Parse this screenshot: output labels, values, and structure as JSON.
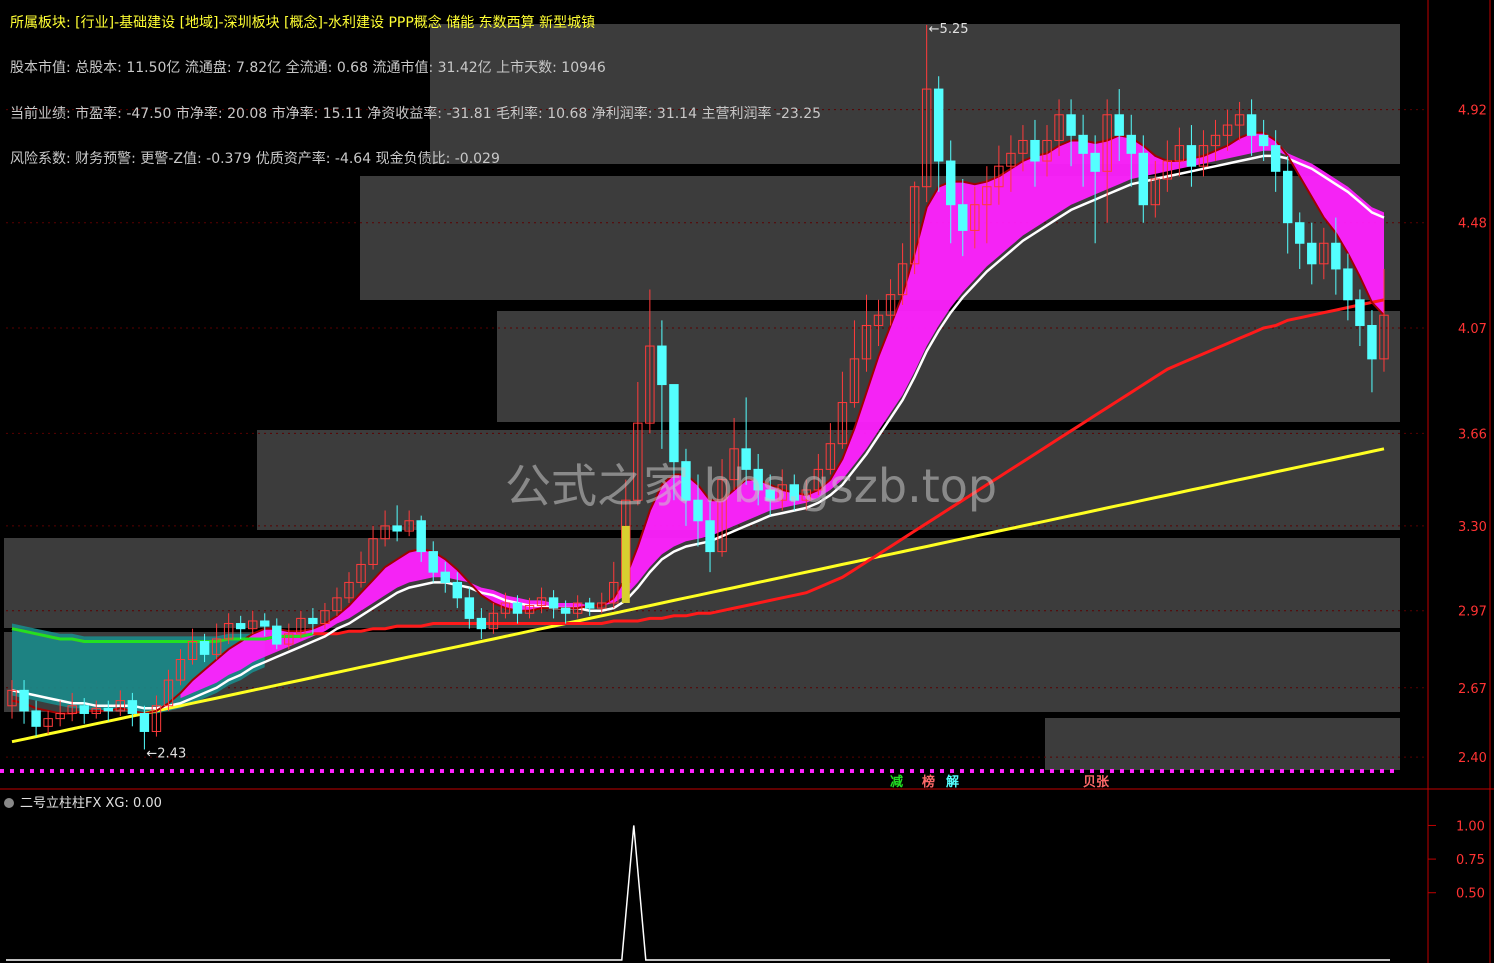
{
  "header": {
    "sector_line": "所属板块: [行业]-基础建设 [地域]-深圳板块 [概念]-水利建设 PPP概念 储能 东数西算 新型城镇",
    "capital_line": "股本市值: 总股本: 11.50亿 流通盘: 7.82亿 全流通: 0.68 流通市值: 31.42亿 上市天数: 10946",
    "performance_line": "当前业绩: 市盈率: -47.50 市净率: 20.08 市净率: 15.11 净资收益率: -31.81 毛利率: 10.68 净利润率: 31.14 主营利润率 -23.25",
    "risk_line": "风险系数: 财务预警: 更警-Z值: -0.379 优质资产率: -4.64 现金负债比: -0.029"
  },
  "watermark": "公式之家 bbs.gszb.top",
  "chart_data": [
    {
      "type": "candlestick",
      "title": "",
      "ylim": [
        2.35,
        5.3
      ],
      "y_ticks": [
        "4.92",
        "4.48",
        "4.07",
        "3.66",
        "3.30",
        "2.97",
        "2.67",
        "2.40"
      ],
      "annotations": {
        "high": "5.25",
        "low": "2.43"
      },
      "signal_labels": [
        "减",
        "榜",
        "解",
        "贝张"
      ],
      "candles": [
        [
          2.6,
          2.66,
          2.55,
          2.7
        ],
        [
          2.66,
          2.58,
          2.53,
          2.7
        ],
        [
          2.58,
          2.52,
          2.48,
          2.62
        ],
        [
          2.52,
          2.55,
          2.49,
          2.58
        ],
        [
          2.55,
          2.57,
          2.52,
          2.62
        ],
        [
          2.57,
          2.6,
          2.54,
          2.65
        ],
        [
          2.6,
          2.57,
          2.53,
          2.63
        ],
        [
          2.57,
          2.59,
          2.55,
          2.62
        ],
        [
          2.59,
          2.58,
          2.54,
          2.62
        ],
        [
          2.58,
          2.62,
          2.56,
          2.66
        ],
        [
          2.62,
          2.57,
          2.52,
          2.65
        ],
        [
          2.57,
          2.5,
          2.43,
          2.6
        ],
        [
          2.5,
          2.6,
          2.48,
          2.64
        ],
        [
          2.6,
          2.7,
          2.58,
          2.74
        ],
        [
          2.7,
          2.78,
          2.68,
          2.82
        ],
        [
          2.78,
          2.85,
          2.76,
          2.9
        ],
        [
          2.85,
          2.8,
          2.77,
          2.88
        ],
        [
          2.8,
          2.86,
          2.78,
          2.92
        ],
        [
          2.86,
          2.92,
          2.84,
          2.96
        ],
        [
          2.92,
          2.9,
          2.86,
          2.95
        ],
        [
          2.9,
          2.93,
          2.88,
          2.97
        ],
        [
          2.93,
          2.91,
          2.87,
          2.96
        ],
        [
          2.91,
          2.84,
          2.82,
          2.94
        ],
        [
          2.84,
          2.88,
          2.82,
          2.92
        ],
        [
          2.88,
          2.94,
          2.86,
          2.97
        ],
        [
          2.94,
          2.92,
          2.88,
          2.98
        ],
        [
          2.92,
          2.97,
          2.9,
          3.0
        ],
        [
          2.97,
          3.02,
          2.95,
          3.06
        ],
        [
          3.02,
          3.08,
          3.0,
          3.12
        ],
        [
          3.08,
          3.15,
          3.06,
          3.2
        ],
        [
          3.15,
          3.25,
          3.13,
          3.3
        ],
        [
          3.25,
          3.3,
          3.22,
          3.36
        ],
        [
          3.3,
          3.28,
          3.24,
          3.38
        ],
        [
          3.28,
          3.32,
          3.26,
          3.36
        ],
        [
          3.32,
          3.2,
          3.16,
          3.34
        ],
        [
          3.2,
          3.12,
          3.08,
          3.24
        ],
        [
          3.12,
          3.08,
          3.04,
          3.16
        ],
        [
          3.08,
          3.02,
          2.98,
          3.12
        ],
        [
          3.02,
          2.94,
          2.9,
          3.06
        ],
        [
          2.94,
          2.9,
          2.86,
          2.98
        ],
        [
          2.9,
          2.96,
          2.88,
          3.0
        ],
        [
          2.96,
          3.0,
          2.94,
          3.04
        ],
        [
          3.0,
          2.96,
          2.92,
          3.03
        ],
        [
          2.96,
          2.99,
          2.94,
          3.02
        ],
        [
          2.99,
          3.02,
          2.96,
          3.06
        ],
        [
          3.02,
          2.98,
          2.94,
          3.05
        ],
        [
          2.98,
          2.96,
          2.92,
          3.01
        ],
        [
          2.96,
          3.0,
          2.94,
          3.03
        ],
        [
          3.0,
          2.98,
          2.95,
          3.02
        ],
        [
          2.98,
          3.0,
          2.96,
          3.04
        ],
        [
          3.0,
          3.08,
          2.98,
          3.16
        ],
        [
          3.08,
          3.4,
          3.06,
          3.48
        ],
        [
          3.4,
          3.7,
          3.38,
          3.86
        ],
        [
          3.7,
          4.0,
          3.66,
          4.22
        ],
        [
          4.0,
          3.85,
          3.6,
          4.1
        ],
        [
          3.85,
          3.55,
          3.4,
          3.72
        ],
        [
          3.55,
          3.4,
          3.3,
          3.6
        ],
        [
          3.4,
          3.32,
          3.22,
          3.5
        ],
        [
          3.32,
          3.2,
          3.12,
          3.4
        ],
        [
          3.2,
          3.48,
          3.18,
          3.56
        ],
        [
          3.48,
          3.6,
          3.44,
          3.72
        ],
        [
          3.6,
          3.52,
          3.46,
          3.8
        ],
        [
          3.52,
          3.44,
          3.38,
          3.58
        ],
        [
          3.44,
          3.4,
          3.34,
          3.5
        ],
        [
          3.4,
          3.46,
          3.36,
          3.52
        ],
        [
          3.46,
          3.4,
          3.36,
          3.5
        ],
        [
          3.4,
          3.44,
          3.36,
          3.48
        ],
        [
          3.44,
          3.52,
          3.42,
          3.58
        ],
        [
          3.52,
          3.62,
          3.5,
          3.7
        ],
        [
          3.62,
          3.78,
          3.6,
          3.9
        ],
        [
          3.78,
          3.95,
          3.76,
          4.1
        ],
        [
          3.95,
          4.08,
          3.9,
          4.2
        ],
        [
          4.08,
          4.12,
          4.0,
          4.18
        ],
        [
          4.12,
          4.2,
          4.08,
          4.26
        ],
        [
          4.2,
          4.32,
          4.16,
          4.4
        ],
        [
          4.32,
          4.62,
          4.28,
          4.64
        ],
        [
          4.62,
          5.0,
          4.56,
          5.25
        ],
        [
          5.0,
          4.72,
          4.6,
          5.05
        ],
        [
          4.72,
          4.55,
          4.4,
          4.8
        ],
        [
          4.55,
          4.45,
          4.35,
          4.65
        ],
        [
          4.45,
          4.55,
          4.38,
          4.62
        ],
        [
          4.55,
          4.62,
          4.4,
          4.7
        ],
        [
          4.62,
          4.7,
          4.55,
          4.78
        ],
        [
          4.7,
          4.75,
          4.6,
          4.82
        ],
        [
          4.75,
          4.8,
          4.68,
          4.86
        ],
        [
          4.8,
          4.72,
          4.62,
          4.88
        ],
        [
          4.72,
          4.8,
          4.66,
          4.86
        ],
        [
          4.8,
          4.9,
          4.74,
          4.96
        ],
        [
          4.9,
          4.82,
          4.7,
          4.96
        ],
        [
          4.82,
          4.75,
          4.62,
          4.9
        ],
        [
          4.75,
          4.68,
          4.4,
          4.82
        ],
        [
          4.68,
          4.9,
          4.48,
          4.96
        ],
        [
          4.9,
          4.82,
          4.72,
          5.0
        ],
        [
          4.82,
          4.75,
          4.62,
          4.9
        ],
        [
          4.75,
          4.55,
          4.48,
          4.82
        ],
        [
          4.55,
          4.65,
          4.5,
          4.72
        ],
        [
          4.65,
          4.72,
          4.6,
          4.8
        ],
        [
          4.72,
          4.78,
          4.66,
          4.85
        ],
        [
          4.78,
          4.7,
          4.62,
          4.86
        ],
        [
          4.7,
          4.78,
          4.66,
          4.84
        ],
        [
          4.78,
          4.82,
          4.72,
          4.88
        ],
        [
          4.82,
          4.86,
          4.76,
          4.92
        ],
        [
          4.86,
          4.9,
          4.8,
          4.95
        ],
        [
          4.9,
          4.82,
          4.74,
          4.96
        ],
        [
          4.82,
          4.78,
          4.72,
          4.88
        ],
        [
          4.78,
          4.68,
          4.6,
          4.84
        ],
        [
          4.68,
          4.48,
          4.36,
          4.74
        ],
        [
          4.48,
          4.4,
          4.3,
          4.52
        ],
        [
          4.4,
          4.32,
          4.24,
          4.48
        ],
        [
          4.32,
          4.4,
          4.26,
          4.46
        ],
        [
          4.4,
          4.3,
          4.2,
          4.5
        ],
        [
          4.3,
          4.18,
          4.1,
          4.36
        ],
        [
          4.18,
          4.08,
          4.0,
          4.22
        ],
        [
          4.08,
          3.95,
          3.82,
          4.14
        ],
        [
          3.95,
          4.12,
          3.9,
          4.3
        ]
      ],
      "ma_fast": [
        2.62,
        2.61,
        2.59,
        2.58,
        2.57,
        2.57,
        2.58,
        2.58,
        2.58,
        2.59,
        2.58,
        2.57,
        2.58,
        2.61,
        2.65,
        2.7,
        2.74,
        2.78,
        2.82,
        2.85,
        2.88,
        2.9,
        2.9,
        2.89,
        2.89,
        2.9,
        2.92,
        2.95,
        2.99,
        3.04,
        3.09,
        3.14,
        3.17,
        3.2,
        3.21,
        3.2,
        3.17,
        3.13,
        3.08,
        3.03,
        3.0,
        2.98,
        2.97,
        2.97,
        2.98,
        2.98,
        2.98,
        2.98,
        2.99,
        2.99,
        3.02,
        3.1,
        3.22,
        3.36,
        3.46,
        3.5,
        3.5,
        3.46,
        3.4,
        3.4,
        3.44,
        3.48,
        3.48,
        3.46,
        3.44,
        3.43,
        3.42,
        3.44,
        3.48,
        3.56,
        3.68,
        3.82,
        3.96,
        4.08,
        4.2,
        4.36,
        4.54,
        4.62,
        4.64,
        4.64,
        4.63,
        4.64,
        4.66,
        4.69,
        4.72,
        4.74,
        4.75,
        4.78,
        4.8,
        4.8,
        4.79,
        4.8,
        4.82,
        4.81,
        4.78,
        4.74,
        4.72,
        4.72,
        4.73,
        4.74,
        4.76,
        4.78,
        4.81,
        4.83,
        4.83,
        4.8,
        4.74,
        4.66,
        4.58,
        4.5,
        4.44,
        4.36,
        4.27,
        4.17,
        4.12
      ],
      "ma_mid": [
        2.68,
        2.67,
        2.66,
        2.65,
        2.64,
        2.63,
        2.63,
        2.62,
        2.62,
        2.62,
        2.62,
        2.61,
        2.61,
        2.62,
        2.63,
        2.65,
        2.67,
        2.69,
        2.72,
        2.74,
        2.77,
        2.79,
        2.81,
        2.83,
        2.85,
        2.87,
        2.89,
        2.92,
        2.94,
        2.97,
        3.0,
        3.03,
        3.06,
        3.08,
        3.09,
        3.1,
        3.1,
        3.09,
        3.08,
        3.06,
        3.05,
        3.03,
        3.02,
        3.01,
        3.01,
        3.0,
        3.0,
        3.0,
        2.99,
        2.99,
        3.0,
        3.03,
        3.08,
        3.14,
        3.19,
        3.22,
        3.24,
        3.25,
        3.26,
        3.28,
        3.3,
        3.32,
        3.34,
        3.36,
        3.37,
        3.38,
        3.39,
        3.41,
        3.44,
        3.48,
        3.54,
        3.6,
        3.67,
        3.74,
        3.81,
        3.9,
        4.0,
        4.08,
        4.15,
        4.21,
        4.26,
        4.31,
        4.35,
        4.39,
        4.43,
        4.46,
        4.49,
        4.52,
        4.55,
        4.57,
        4.59,
        4.61,
        4.63,
        4.65,
        4.66,
        4.67,
        4.68,
        4.69,
        4.7,
        4.71,
        4.72,
        4.73,
        4.74,
        4.75,
        4.76,
        4.76,
        4.75,
        4.73,
        4.71,
        4.68,
        4.65,
        4.62,
        4.58,
        4.54,
        4.52
      ],
      "ma_slow": [
        2.9,
        2.89,
        2.88,
        2.87,
        2.86,
        2.86,
        2.85,
        2.85,
        2.85,
        2.85,
        2.85,
        2.85,
        2.85,
        2.85,
        2.85,
        2.85,
        2.85,
        2.85,
        2.86,
        2.86,
        2.86,
        2.86,
        2.87,
        2.87,
        2.87,
        2.88,
        2.88,
        2.88,
        2.89,
        2.89,
        2.9,
        2.9,
        2.91,
        2.91,
        2.91,
        2.92,
        2.92,
        2.92,
        2.92,
        2.92,
        2.92,
        2.92,
        2.92,
        2.92,
        2.92,
        2.92,
        2.92,
        2.92,
        2.92,
        2.92,
        2.93,
        2.93,
        2.93,
        2.94,
        2.94,
        2.95,
        2.95,
        2.96,
        2.96,
        2.97,
        2.98,
        2.99,
        3.0,
        3.01,
        3.02,
        3.03,
        3.04,
        3.06,
        3.08,
        3.1,
        3.13,
        3.16,
        3.19,
        3.22,
        3.25,
        3.28,
        3.31,
        3.34,
        3.37,
        3.4,
        3.43,
        3.46,
        3.49,
        3.52,
        3.55,
        3.58,
        3.61,
        3.64,
        3.67,
        3.7,
        3.73,
        3.76,
        3.79,
        3.82,
        3.85,
        3.88,
        3.91,
        3.93,
        3.95,
        3.97,
        3.99,
        4.01,
        4.03,
        4.05,
        4.07,
        4.08,
        4.1,
        4.11,
        4.12,
        4.13,
        4.14,
        4.15,
        4.16,
        4.17,
        4.18
      ],
      "ma_long": [
        2.46,
        2.47,
        2.48,
        2.49,
        2.5,
        2.51,
        2.52,
        2.53,
        2.54,
        2.55,
        2.56,
        2.57,
        2.58,
        2.59,
        2.6,
        2.61,
        2.62,
        2.63,
        2.64,
        2.65,
        2.66,
        2.67,
        2.68,
        2.69,
        2.7,
        2.71,
        2.72,
        2.73,
        2.74,
        2.75,
        2.76,
        2.77,
        2.78,
        2.79,
        2.8,
        2.81,
        2.82,
        2.83,
        2.84,
        2.85,
        2.86,
        2.87,
        2.88,
        2.89,
        2.9,
        2.91,
        2.92,
        2.93,
        2.94,
        2.95,
        2.96,
        2.97,
        2.98,
        2.99,
        3.0,
        3.01,
        3.02,
        3.03,
        3.04,
        3.05,
        3.06,
        3.07,
        3.08,
        3.09,
        3.1,
        3.11,
        3.12,
        3.13,
        3.14,
        3.15,
        3.16,
        3.17,
        3.18,
        3.19,
        3.2,
        3.21,
        3.22,
        3.23,
        3.24,
        3.25,
        3.26,
        3.27,
        3.28,
        3.29,
        3.3,
        3.31,
        3.32,
        3.33,
        3.34,
        3.35,
        3.36,
        3.37,
        3.38,
        3.39,
        3.4,
        3.41,
        3.42,
        3.43,
        3.44,
        3.45,
        3.46,
        3.47,
        3.48,
        3.49,
        3.5,
        3.51,
        3.52,
        3.53,
        3.54,
        3.55,
        3.56,
        3.57,
        3.58,
        3.59,
        3.6
      ],
      "colors": {
        "up": "#ff3b3b",
        "down": "#54ffff",
        "band": "#ff22ff",
        "band_lower": "#ffffff",
        "ma_fast": "#a00000",
        "ma_mid": "#1a1aff",
        "ma_slow": "#ff1a1a",
        "ma_long": "#ffff22",
        "green_line": "#22e022",
        "teal_band": "#1a8a8a",
        "panel": "#3c3c3c"
      }
    },
    {
      "type": "line",
      "title": "二号立柱柱FX XG: 0.00",
      "ylim": [
        0,
        1.1
      ],
      "y_ticks": [
        "1.00",
        "0.75",
        "0.50"
      ],
      "values_note": "single spike to 1.00 at bar 51, otherwise 0",
      "spike_index": 51,
      "spike_value": 1.0
    }
  ]
}
